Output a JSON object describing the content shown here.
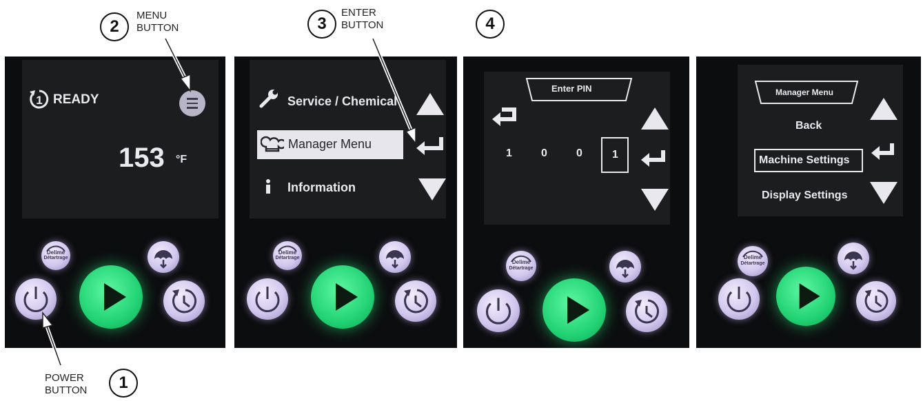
{
  "callouts": {
    "menu": {
      "number": "2",
      "label_line1": "MENU",
      "label_line2": "BUTTON"
    },
    "enter": {
      "number": "3",
      "label_line1": "ENTER",
      "label_line2": "BUTTON"
    },
    "step4": {
      "number": "4"
    },
    "power": {
      "number": "1",
      "label_line1": "POWER",
      "label_line2": "BUTTON"
    }
  },
  "panel1": {
    "status": "READY",
    "temperature": "153",
    "unit": "°F"
  },
  "panel2": {
    "items": [
      "Service / Chemical",
      "Manager Menu",
      "Information"
    ]
  },
  "panel3": {
    "title": "Enter PIN",
    "digits": [
      "1",
      "0",
      "0",
      "1"
    ]
  },
  "panel4": {
    "title": "Manager Menu",
    "items": [
      "Back",
      "Machine Settings",
      "Display Settings"
    ]
  },
  "controls": {
    "delime_line1": "Delime",
    "delime_line2": "Détartrage"
  },
  "icons": [
    "cycle-icon",
    "menu-icon",
    "wrench-icon",
    "chef-hat-icon",
    "info-icon",
    "up-arrow-icon",
    "down-arrow-icon",
    "enter-icon",
    "back-icon",
    "power-icon",
    "play-icon",
    "drain-icon",
    "delime-icon"
  ],
  "colors": {
    "screen_bg": "#1c1d1f",
    "panel_bg": "#0c0d0f",
    "button_lavender": "#d2c7ee",
    "button_green": "#22d374",
    "text": "#e9e9ee"
  }
}
